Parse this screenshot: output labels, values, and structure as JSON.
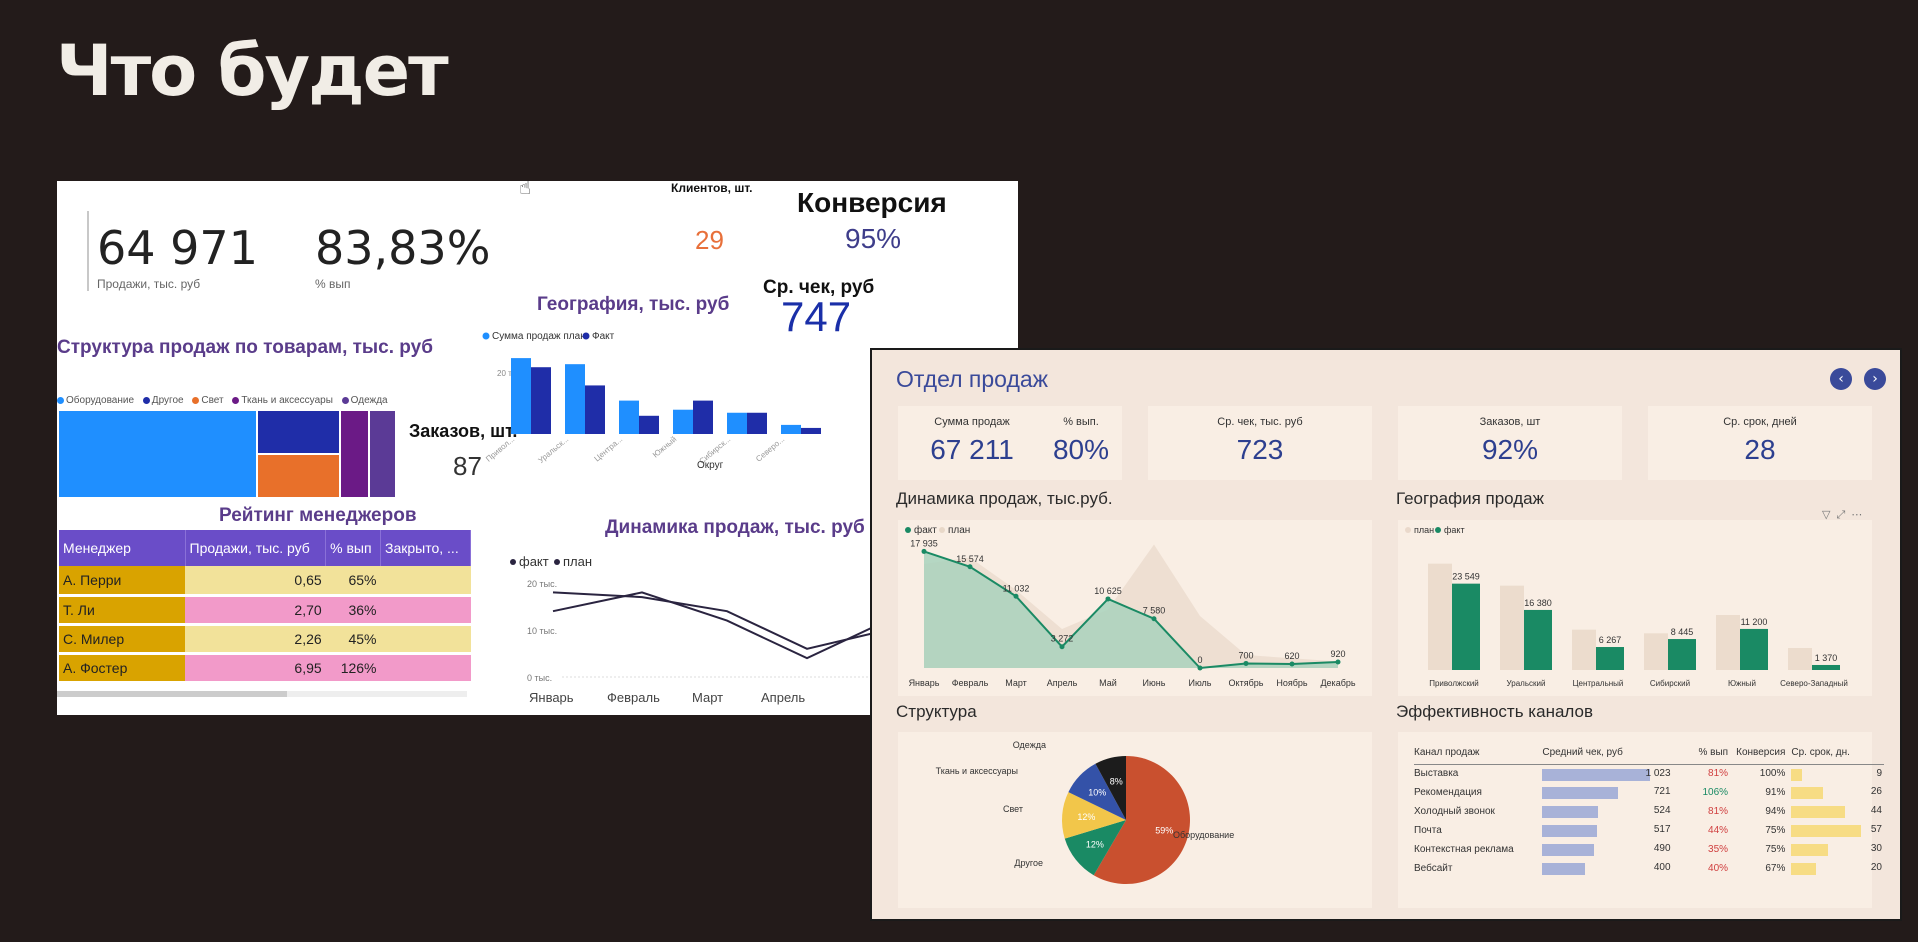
{
  "slide": {
    "title": "Что будет"
  },
  "left_dashboard": {
    "kpi1": {
      "value": "64 971",
      "caption": "Продажи, тыс. руб"
    },
    "kpi2": {
      "value": "83,83%",
      "caption": "% вып"
    },
    "clients": {
      "label": "Клиентов, шт.",
      "value": "29"
    },
    "conversion": {
      "label": "Конверсия",
      "value": "95%"
    },
    "avg_check": {
      "label": "Ср. чек, руб",
      "value": "747"
    },
    "orders": {
      "label": "Заказов, шт.",
      "value": "87"
    },
    "structure": {
      "title": "Структура продаж по товарам, тыс. руб",
      "legend": [
        {
          "name": "Оборудование",
          "color": "#1f8fff"
        },
        {
          "name": "Другое",
          "color": "#1f2da8"
        },
        {
          "name": "Свет",
          "color": "#e8702a"
        },
        {
          "name": "Ткань и аксессуары",
          "color": "#6b1a86"
        },
        {
          "name": "Одежда",
          "color": "#5b3a96"
        }
      ]
    },
    "geography": {
      "title": "География, тыс. руб",
      "legend": [
        "Сумма продаж план",
        "Факт"
      ],
      "tick": "20 тыс.",
      "xlabel": "Округ",
      "categories": [
        "Привол...",
        "Уральск...",
        "Центра...",
        "Южный",
        "Сибирск...",
        "Северо..."
      ]
    },
    "chart_data": {
      "type": "bar",
      "categories": [
        "Привол...",
        "Уральск...",
        "Центра...",
        "Южный",
        "Сибирск...",
        "Северо..."
      ],
      "series": [
        {
          "name": "Сумма продаж план",
          "values": [
            25,
            23,
            11,
            8,
            7,
            3
          ]
        },
        {
          "name": "Факт",
          "values": [
            22,
            16,
            6,
            11,
            7,
            2
          ]
        }
      ],
      "ylim": [
        0,
        28
      ]
    },
    "ranking": {
      "title": "Рейтинг менеджеров",
      "columns": [
        "Менеджер",
        "Продажи, тыс. руб",
        "% вып",
        "Закрыто, ..."
      ],
      "rows": [
        {
          "name": "А. Перри",
          "sales": "0,65",
          "pct": "65%"
        },
        {
          "name": "Т. Ли",
          "sales": "2,70",
          "pct": "36%"
        },
        {
          "name": "С. Милер",
          "sales": "2,26",
          "pct": "45%"
        },
        {
          "name": "А. Фостер",
          "sales": "6,95",
          "pct": "126%"
        }
      ]
    },
    "dynamics": {
      "title": "Динамика продаж, тыс. руб",
      "legend": [
        "факт",
        "план"
      ],
      "ticks": [
        "20 тыс.",
        "10 тыс.",
        "0 тыс."
      ],
      "months": [
        "Январь",
        "Февраль",
        "Март",
        "Апрель"
      ],
      "fact": [
        18,
        17,
        14,
        6,
        10
      ],
      "plan": [
        14,
        18,
        12,
        4,
        12
      ]
    }
  },
  "right_dashboard": {
    "title": "Отдел продаж",
    "nav": {
      "prev": "‹",
      "next": "›"
    },
    "cards": [
      {
        "caption": "Сумма продаж",
        "value": "67 211"
      },
      {
        "caption": "% вып.",
        "value": "80%"
      },
      {
        "caption": "Ср. чек, тыс. руб",
        "value": "723"
      },
      {
        "caption": "Заказов, шт",
        "value": "92%"
      },
      {
        "caption": "Ср. срок, дней",
        "value": "28"
      }
    ],
    "dynamics": {
      "title": "Динамика продаж, тыс.руб.",
      "legend": [
        "факт",
        "план"
      ],
      "months": [
        "Январь",
        "Февраль",
        "Март",
        "Апрель",
        "Май",
        "Июнь",
        "Июль",
        "Октябрь",
        "Ноябрь",
        "Декабрь"
      ],
      "labels": [
        "17 935",
        "15 574",
        "11 032",
        "3 272",
        "10 625",
        "7 580",
        "0",
        "700",
        "620",
        "920"
      ],
      "fact": [
        17935,
        15574,
        11032,
        3272,
        10625,
        7580,
        0,
        700,
        620,
        920
      ],
      "plan": [
        16000,
        17000,
        12000,
        6000,
        9000,
        19000,
        8000,
        2000,
        1500,
        1000
      ]
    },
    "geography": {
      "title": "География продаж",
      "legend": [
        "план",
        "факт"
      ],
      "categories": [
        "Приволжский",
        "Уральский",
        "Центральный",
        "Сибирский",
        "Южный",
        "Северо-Западный"
      ],
      "fact": [
        23549,
        16380,
        6267,
        8445,
        11200,
        1370
      ],
      "plan": [
        29000,
        23000,
        11000,
        10000,
        15000,
        6000
      ],
      "labels": [
        "23 549",
        "16 380",
        "6 267",
        "8 445",
        "11 200",
        "1 370"
      ]
    },
    "structure": {
      "title": "Структура",
      "slices": [
        {
          "name": "Оборудование",
          "pct": 59,
          "label": "59%",
          "color": "#c9502f"
        },
        {
          "name": "Другое",
          "pct": 12,
          "label": "12%",
          "color": "#1a8a64"
        },
        {
          "name": "Свет",
          "pct": 12,
          "label": "12%",
          "color": "#f2c64a"
        },
        {
          "name": "Ткань и аксессуары",
          "pct": 10,
          "label": "10%",
          "color": "#3452a8"
        },
        {
          "name": "Одежда",
          "pct": 8,
          "label": "8%",
          "color": "#1c1c1c"
        }
      ]
    },
    "channels": {
      "title": "Эффективность каналов",
      "columns": [
        "Канал продаж",
        "Средний чек, руб",
        "% вып",
        "Конверсия",
        "Ср. срок, дн."
      ],
      "rows": [
        {
          "name": "Выставка",
          "avg": "1 023",
          "avg_n": 1023,
          "pct": "81%",
          "pct_color": "#d04040",
          "conv": "100%",
          "days": "9",
          "days_n": 9
        },
        {
          "name": "Рекомендация",
          "avg": "721",
          "avg_n": 721,
          "pct": "106%",
          "pct_color": "#1a8a64",
          "conv": "91%",
          "days": "26",
          "days_n": 26
        },
        {
          "name": "Холодный звонок",
          "avg": "524",
          "avg_n": 524,
          "pct": "81%",
          "pct_color": "#d04040",
          "conv": "94%",
          "days": "44",
          "days_n": 44
        },
        {
          "name": "Почта",
          "avg": "517",
          "avg_n": 517,
          "pct": "44%",
          "pct_color": "#d04040",
          "conv": "75%",
          "days": "57",
          "days_n": 57
        },
        {
          "name": "Контекстная реклама",
          "avg": "490",
          "avg_n": 490,
          "pct": "35%",
          "pct_color": "#d04040",
          "conv": "75%",
          "days": "30",
          "days_n": 30
        },
        {
          "name": "Вебсайт",
          "avg": "400",
          "avg_n": 400,
          "pct": "40%",
          "pct_color": "#d04040",
          "conv": "67%",
          "days": "20",
          "days_n": 20
        }
      ]
    }
  }
}
